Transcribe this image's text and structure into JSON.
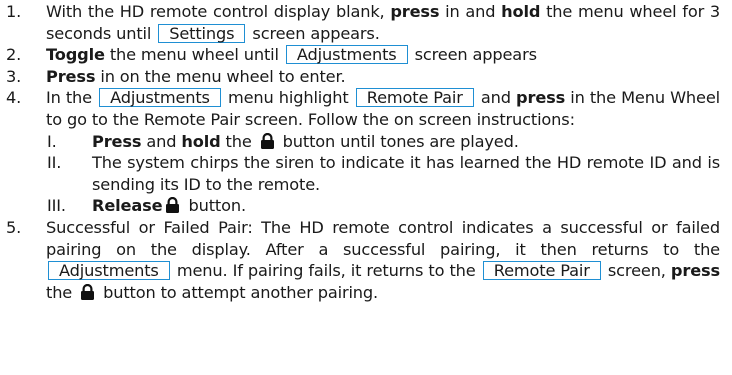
{
  "steps": [
    {
      "num": "1.",
      "t1": "With the HD remote control display blank, ",
      "b1": "press",
      "t2": " in and ",
      "b2": "hold",
      "t3": " the menu wheel for 3 seconds until ",
      "box1": "Settings",
      "t4": " screen appears."
    },
    {
      "num": "2.",
      "b1": "Toggle",
      "t1": " the menu wheel until ",
      "box1": "Adjustments",
      "t2": " screen appears"
    },
    {
      "num": "3.",
      "b1": "Press",
      "t1": " in on the menu wheel to enter."
    },
    {
      "num": "4.",
      "t1": "In the ",
      "box1": "Adjustments",
      "t2": " menu highlight ",
      "box2": "Remote Pair",
      "t3": " and ",
      "b1": "press",
      "t4": " in the Menu Wheel to go to the Remote Pair screen. Follow the on screen instructions:",
      "sub": [
        {
          "num": "I.",
          "b1": "Press",
          "t1": " and ",
          "b2": "hold",
          "t2": " the ",
          "icon": "lock-icon",
          "t3": " button until tones are played."
        },
        {
          "num": "II.",
          "t1": "The system chirps the siren to indicate it has learned the HD remote ID and is sending its ID to the remote."
        },
        {
          "num": "III.",
          "b1": "Release",
          "icon": "lock-icon",
          "t1": " button."
        }
      ]
    },
    {
      "num": "5.",
      "t1": "Successful or Failed Pair: The HD remote control indicates a successful or failed pairing on the display. After a successful pairing, it then returns to the ",
      "box1": "Adjustments",
      "t2": " menu. If pairing fails, it returns to the ",
      "box2": "Remote Pair",
      "t3": " screen, ",
      "b1": "press",
      "t4": " the ",
      "icon": "lock-icon",
      "t5": " button to attempt another pairing."
    }
  ],
  "colors": {
    "text": "#1a1a1a",
    "box_border": "#1f8fd3"
  }
}
